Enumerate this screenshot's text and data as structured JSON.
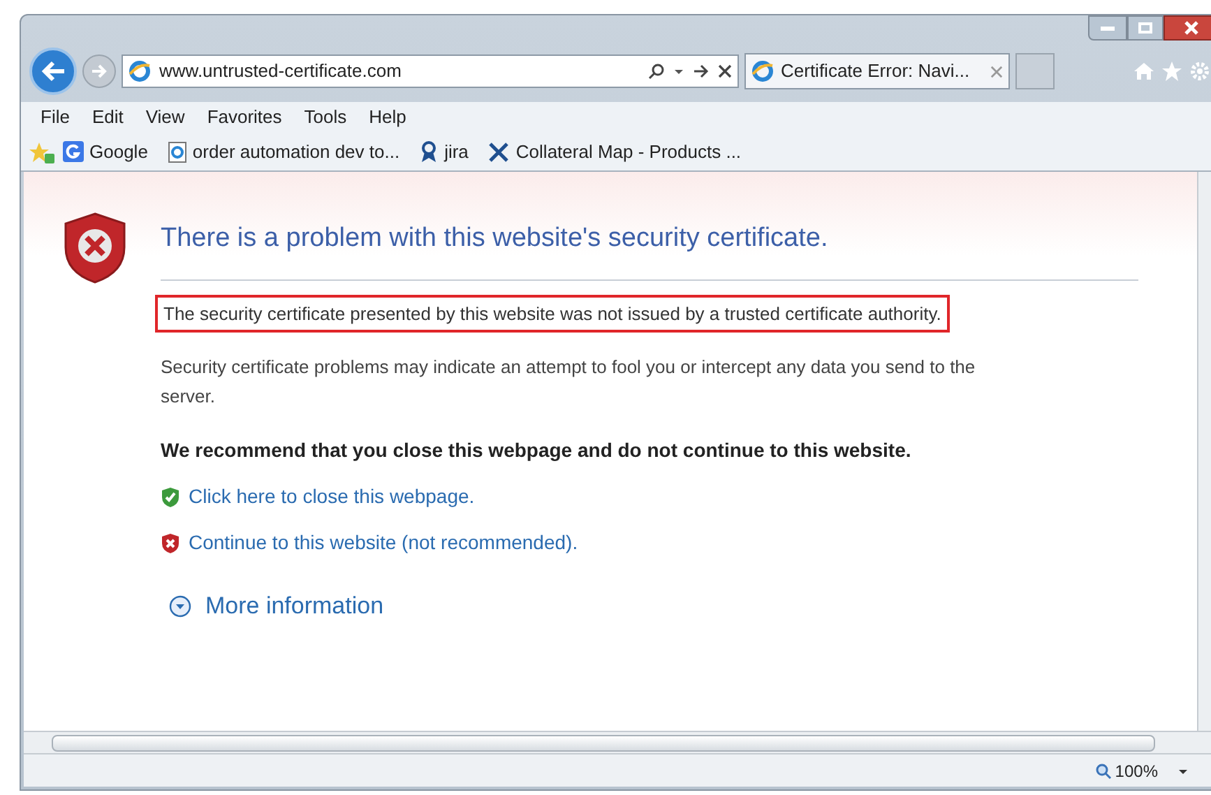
{
  "address_bar": {
    "url": "www.untrusted-certificate.com"
  },
  "tab": {
    "title": "Certificate Error: Navi..."
  },
  "menu": [
    "File",
    "Edit",
    "View",
    "Favorites",
    "Tools",
    "Help"
  ],
  "favorites": [
    {
      "label": "Google",
      "kind": "google"
    },
    {
      "label": "order automation dev to...",
      "kind": "page"
    },
    {
      "label": "jira",
      "kind": "ribbon"
    },
    {
      "label": "Collateral Map - Products ...",
      "kind": "tools"
    }
  ],
  "page": {
    "heading": "There is a problem with this website's security certificate.",
    "highlighted_message": "The security certificate presented by this website was not issued by a trusted certificate authority.",
    "description": "Security certificate problems may indicate an attempt to fool you or intercept any data you send to the server.",
    "recommendation": "We recommend that you close this webpage and do not continue to this website.",
    "links": [
      {
        "label": "Click here to close this webpage.",
        "kind": "safe"
      },
      {
        "label": "Continue to this website (not recommended).",
        "kind": "unsafe"
      }
    ],
    "more_information": "More information"
  },
  "status_bar": {
    "zoom": "100%"
  }
}
